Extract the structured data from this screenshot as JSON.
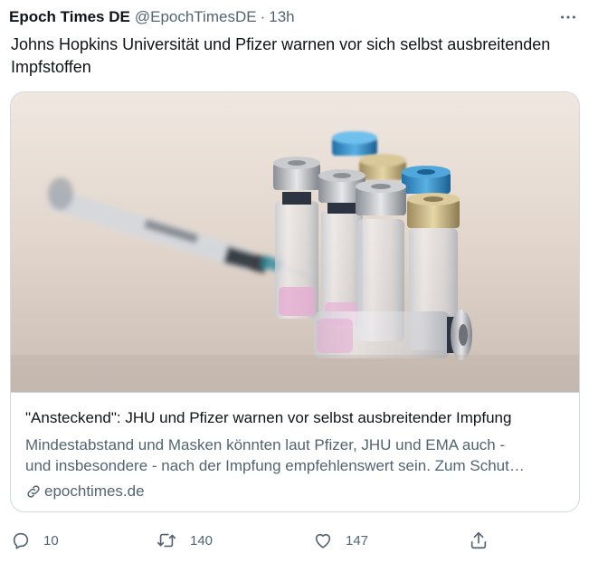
{
  "tweet": {
    "author_name": "Epoch Times DE",
    "handle": "@EpochTimesDE",
    "separator": "·",
    "time": "13h",
    "text": "Johns Hopkins Universität und Pfizer warnen vor sich selbst ausbreitenden Impfstoffen"
  },
  "card": {
    "title": "\"Ansteckend\": JHU und Pfizer warnen vor selbst ausbreitender Impfung",
    "description_line1": "Mindestabstand und Masken könnten laut Pfizer, JHU und EMA auch -",
    "description_line2": "und insbesondere - nach der Impfung empfehlenswert sein. Zum Schut…",
    "domain": "epochtimes.de"
  },
  "actions": {
    "reply_count": "10",
    "retweet_count": "140",
    "like_count": "147"
  },
  "icons": {
    "more": "more-icon",
    "reply": "reply-icon",
    "retweet": "retweet-icon",
    "like": "heart-icon",
    "share": "share-icon",
    "link": "link-icon"
  },
  "colors": {
    "text": "#0f1419",
    "secondary": "#536471",
    "border": "#cfd9de"
  }
}
